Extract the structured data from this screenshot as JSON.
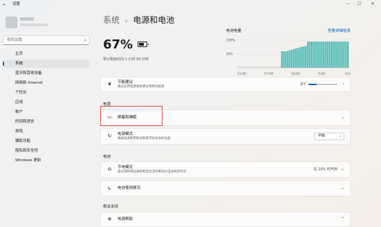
{
  "window": {
    "title": "设置",
    "back_glyph": "←",
    "minimize": "—",
    "maximize": "☐",
    "close": "✕"
  },
  "sidebar": {
    "search_placeholder": "查找设置",
    "items": [
      {
        "label": "主页"
      },
      {
        "label": "系统",
        "active": true
      },
      {
        "label": "蓝牙和其他设备"
      },
      {
        "label": "网络和 Internet"
      },
      {
        "label": "个性化"
      },
      {
        "label": "应用"
      },
      {
        "label": "帐户"
      },
      {
        "label": "时间和语言"
      },
      {
        "label": "游戏"
      },
      {
        "label": "辅助功能"
      },
      {
        "label": "隐私和安全性"
      },
      {
        "label": "Windows 更新"
      }
    ]
  },
  "header": {
    "parent": "系统",
    "separator": "›",
    "current": "电源和电池"
  },
  "battery": {
    "percent_label": "67%",
    "estimate": "预计剩余时间 1 小时 58 分钟",
    "chart_title": "电池电量",
    "details_link": "查看详细信息"
  },
  "chart_data": {
    "type": "bar",
    "y_ticks": [
      "100%",
      "50%"
    ],
    "x_ticks": [
      "11:00",
      "17:00",
      "23:00",
      "5:00",
      "11:00"
    ],
    "values": [
      0.05,
      0.05,
      0.05,
      0.05,
      0.05,
      0.05,
      0.05,
      0.05,
      0.05,
      0.05,
      0.05,
      0.05,
      0.05,
      0.05,
      0.05,
      0.05,
      0.05,
      0.05,
      0.05,
      0.05,
      0.05,
      0.05,
      0.6,
      0.6,
      0.6,
      0.62,
      0.64,
      0.66,
      0.68,
      0.7,
      0.72,
      0.74,
      0.76,
      0.78,
      0.8,
      0.95,
      0.95,
      0.95,
      0.95,
      0.95,
      0.95,
      0.95,
      0.95,
      0.95,
      0.95,
      0.95,
      0.95,
      0.95,
      0.95,
      0.95,
      0.95,
      0.95,
      0.95,
      0.95,
      0.95,
      0.95
    ],
    "bar_color": "#3fb8b2",
    "empty_color": "#d8dbde"
  },
  "cards": {
    "recommend": {
      "title": "节能建议",
      "desc": "通过应用电源相关建议来降低能源",
      "count": "2/7",
      "progress": 0.28
    },
    "power_section": "电源",
    "screen_sleep": {
      "title": "屏幕和睡眠"
    },
    "power_mode": {
      "title": "电源模式",
      "desc": "根据电源使用情况和要求优化你的设备",
      "value": "平衡"
    },
    "battery_section": "电池",
    "saver": {
      "title": "节电模式",
      "desc": "通过限制某些通知和后台活动来延长电池续航时间",
      "status": "在 20% 时开启"
    },
    "usage": {
      "title": "电池使用情况"
    },
    "support_section": "相关支持",
    "help": {
      "title": "电源帮助"
    }
  }
}
